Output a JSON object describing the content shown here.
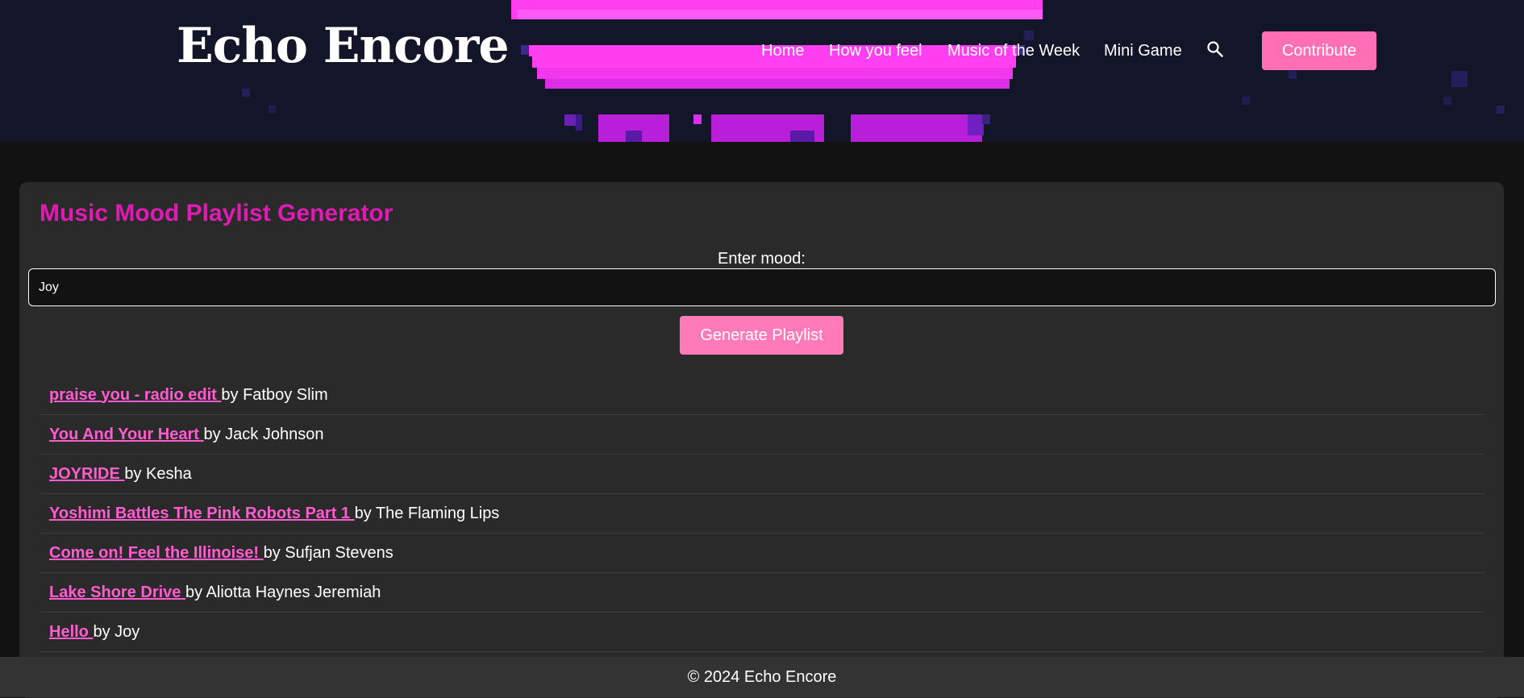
{
  "site": {
    "logo": "Echo Encore"
  },
  "nav": {
    "items": [
      {
        "label": "Home"
      },
      {
        "label": "How you feel"
      },
      {
        "label": "Music of the Week"
      },
      {
        "label": "Mini Game"
      }
    ],
    "search_icon": "search-icon",
    "contribute_label": "Contribute"
  },
  "generator": {
    "title": "Music Mood Playlist Generator",
    "mood_label": "Enter mood:",
    "mood_value": "Joy",
    "button_label": "Generate Playlist"
  },
  "playlist": [
    {
      "title": "praise you - radio edit ",
      "artist": "by Fatboy Slim"
    },
    {
      "title": "You And Your Heart ",
      "artist": "by Jack Johnson"
    },
    {
      "title": "JOYRIDE ",
      "artist": "by Kesha"
    },
    {
      "title": "Yoshimi Battles The Pink Robots Part 1 ",
      "artist": "by The Flaming Lips"
    },
    {
      "title": "Come on! Feel the Illinoise! ",
      "artist": "by Sufjan Stevens"
    },
    {
      "title": "Lake Shore Drive ",
      "artist": "by Aliotta Haynes Jeremiah"
    },
    {
      "title": "Hello ",
      "artist": "by Joy"
    }
  ],
  "footer": {
    "text": "© 2024 Echo Encore"
  },
  "colors": {
    "header_bg": "#131628",
    "page_bg": "#121212",
    "card_bg": "#2a2a2a",
    "title": "#e01bb3",
    "link": "#ff5ccf",
    "button": "#ff7ab8",
    "pixel_pink": "#ff3ff0",
    "pixel_purple": "#b91fd8"
  }
}
